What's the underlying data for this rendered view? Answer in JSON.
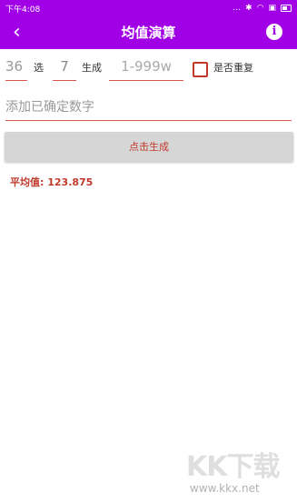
{
  "status": {
    "time": "下午4:08",
    "icons": [
      "dots-icon",
      "bluetooth-icon",
      "wifi-icon",
      "sim-icon",
      "battery-icon"
    ]
  },
  "app_bar": {
    "title": "均值演算",
    "back": "back-icon",
    "info": "info-icon"
  },
  "form": {
    "count_value": "36",
    "select_label": "选",
    "select_value": "7",
    "generate_label": "生成",
    "range_placeholder": "1-999w",
    "repeat_label": "是否重复",
    "add_placeholder": "添加已确定数字"
  },
  "button": {
    "generate": "点击生成"
  },
  "result": {
    "average": "平均值: 123.875"
  },
  "watermark": {
    "logo": "KK下载",
    "url": "www.kkx.net"
  },
  "colors": {
    "primary": "#a100e6",
    "accent": "#c0392b"
  }
}
